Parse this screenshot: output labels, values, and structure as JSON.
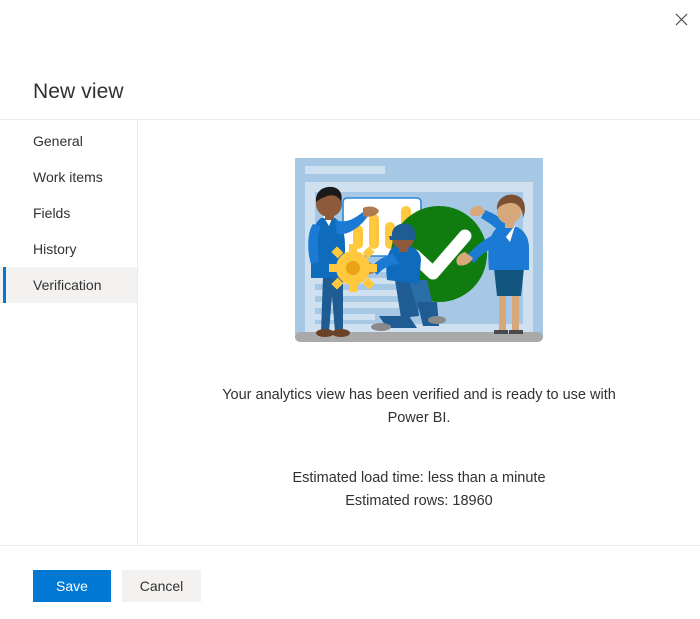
{
  "window": {
    "title": "New view",
    "close_icon": "close-icon",
    "close_label": "Close"
  },
  "sidebar": {
    "items": [
      {
        "label": "General",
        "selected": false
      },
      {
        "label": "Work items",
        "selected": false
      },
      {
        "label": "Fields",
        "selected": false
      },
      {
        "label": "History",
        "selected": false
      },
      {
        "label": "Verification",
        "selected": true
      }
    ]
  },
  "content": {
    "illustration": {
      "name": "analytics-verified-illustration",
      "alt": "Team verifying an analytics dashboard with a green check mark"
    },
    "message": "Your analytics view has been verified and is ready to use with Power BI.",
    "stats": {
      "load_time": "Estimated load time: less than a minute",
      "rows": "Estimated rows: 18960"
    }
  },
  "footer": {
    "save_label": "Save",
    "cancel_label": "Cancel"
  },
  "colors": {
    "accent": "#0078d4",
    "success": "#107c10",
    "selected_background": "#f3f2f1",
    "divider": "#edebe9",
    "text": "#323130",
    "chart_bar": "#ffc83d",
    "figure_blue": "#0f6cbd",
    "figure_dark_blue": "#1f5c94"
  }
}
